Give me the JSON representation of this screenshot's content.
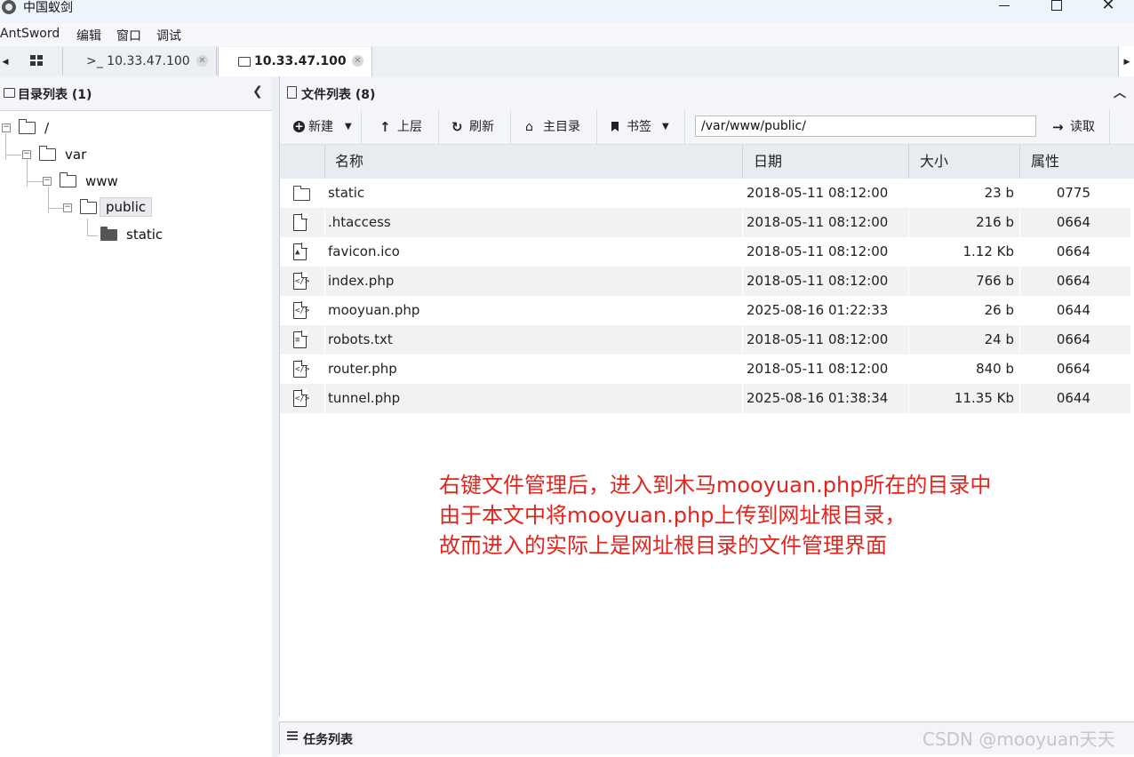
{
  "window": {
    "title": "中国蚁剑"
  },
  "menu": {
    "items": [
      "AntSword",
      "编辑",
      "窗口",
      "调试"
    ]
  },
  "tabs": {
    "terminal_tab": ">_ 10.33.47.100",
    "files_tab": "10.33.47.100"
  },
  "left": {
    "header": "目录列表 (1)",
    "tree": {
      "root": "/",
      "var": "var",
      "www": "www",
      "public": "public",
      "static": "static"
    }
  },
  "right": {
    "header": "文件列表 (8)",
    "toolbar": {
      "new": "新建",
      "up": "上层",
      "refresh": "刷新",
      "home": "主目录",
      "bookmark": "书签",
      "path": "/var/www/public/",
      "read": "读取"
    },
    "columns": {
      "name": "名称",
      "date": "日期",
      "size": "大小",
      "perm": "属性"
    },
    "files": [
      {
        "icon": "folder-icon",
        "name": "static",
        "date": "2018-05-11 08:12:00",
        "size": "23 b",
        "perm": "0775"
      },
      {
        "icon": "file-icon",
        "name": ".htaccess",
        "date": "2018-05-11 08:12:00",
        "size": "216 b",
        "perm": "0664"
      },
      {
        "icon": "image-file-icon",
        "name": "favicon.ico",
        "date": "2018-05-11 08:12:00",
        "size": "1.12 Kb",
        "perm": "0664"
      },
      {
        "icon": "code-file-icon",
        "name": "index.php",
        "date": "2018-05-11 08:12:00",
        "size": "766 b",
        "perm": "0664"
      },
      {
        "icon": "code-file-icon",
        "name": "mooyuan.php",
        "date": "2025-08-16 01:22:33",
        "size": "26 b",
        "perm": "0644"
      },
      {
        "icon": "text-file-icon",
        "name": "robots.txt",
        "date": "2018-05-11 08:12:00",
        "size": "24 b",
        "perm": "0664"
      },
      {
        "icon": "code-file-icon",
        "name": "router.php",
        "date": "2018-05-11 08:12:00",
        "size": "840 b",
        "perm": "0664"
      },
      {
        "icon": "code-file-icon",
        "name": "tunnel.php",
        "date": "2025-08-16 01:38:34",
        "size": "11.35 Kb",
        "perm": "0644"
      }
    ]
  },
  "annotation": {
    "line1": "右键文件管理后，进入到木马mooyuan.php所在的目录中",
    "line2": "由于本文中将mooyuan.php上传到网址根目录，",
    "line3": "故而进入的实际上是网址根目录的文件管理界面"
  },
  "tasks": {
    "header": "任务列表"
  },
  "watermark": "CSDN @mooyuan天天",
  "colors": {
    "annotation": "#e4241c",
    "toolbar_bg": "#f3f5f8",
    "row_alt": "#f1f2f4"
  }
}
